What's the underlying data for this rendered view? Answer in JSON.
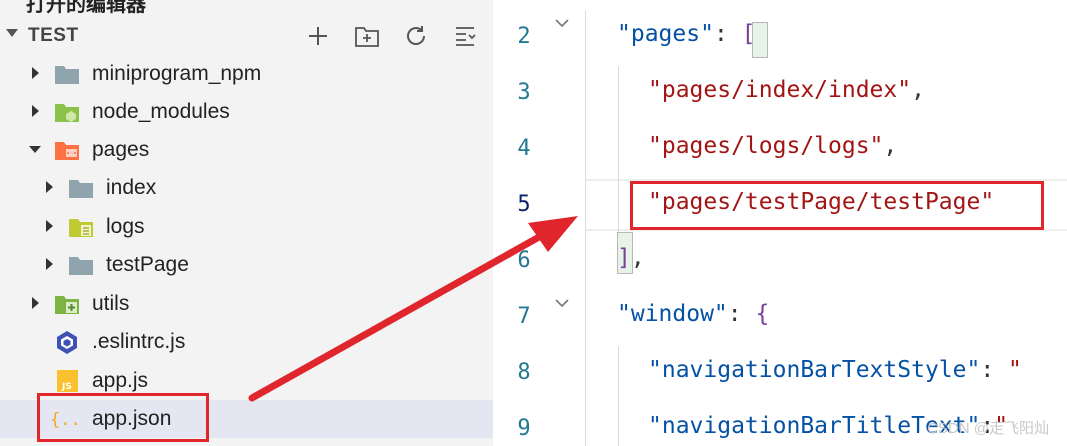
{
  "explorer": {
    "top_cut_text": "打开的编辑器",
    "workspace_title": "TEST",
    "actions": [
      "new-file",
      "new-folder",
      "refresh",
      "collapse-all"
    ],
    "tree": [
      {
        "label": "miniprogram_npm",
        "icon": "folder-gray-icon",
        "expanded": false
      },
      {
        "label": "node_modules",
        "icon": "folder-node-icon",
        "expanded": false
      },
      {
        "label": "pages",
        "icon": "folder-pages-icon",
        "expanded": true
      },
      {
        "label": "index",
        "icon": "folder-gray-icon",
        "expanded": false
      },
      {
        "label": "logs",
        "icon": "folder-logs-icon",
        "expanded": false
      },
      {
        "label": "testPage",
        "icon": "folder-gray-icon",
        "expanded": false
      },
      {
        "label": "utils",
        "icon": "folder-utils-icon",
        "expanded": false
      },
      {
        "label": ".eslintrc.js",
        "icon": "eslint-icon"
      },
      {
        "label": "app.js",
        "icon": "js-file-icon"
      },
      {
        "label": "app.json",
        "icon": "json-file-icon",
        "selected": true
      }
    ]
  },
  "editor": {
    "lines": [
      {
        "num": "2",
        "text": "\"pages\": ["
      },
      {
        "num": "3",
        "text": "\"pages/index/index\","
      },
      {
        "num": "4",
        "text": "\"pages/logs/logs\","
      },
      {
        "num": "5",
        "text": "\"pages/testPage/testPage\""
      },
      {
        "num": "6",
        "text": "],"
      },
      {
        "num": "7",
        "text": "\"window\": {"
      },
      {
        "num": "8",
        "text": "\"navigationBarTextStyle\": \""
      },
      {
        "num": "9",
        "text": "\"navigationBarTitleText\":\""
      }
    ],
    "active_line": "5"
  },
  "watermark": "CSDN @走飞阳灿",
  "colors": {
    "highlight_red": "#e0262c",
    "key_blue": "#0451a5",
    "string_red": "#a31515"
  }
}
